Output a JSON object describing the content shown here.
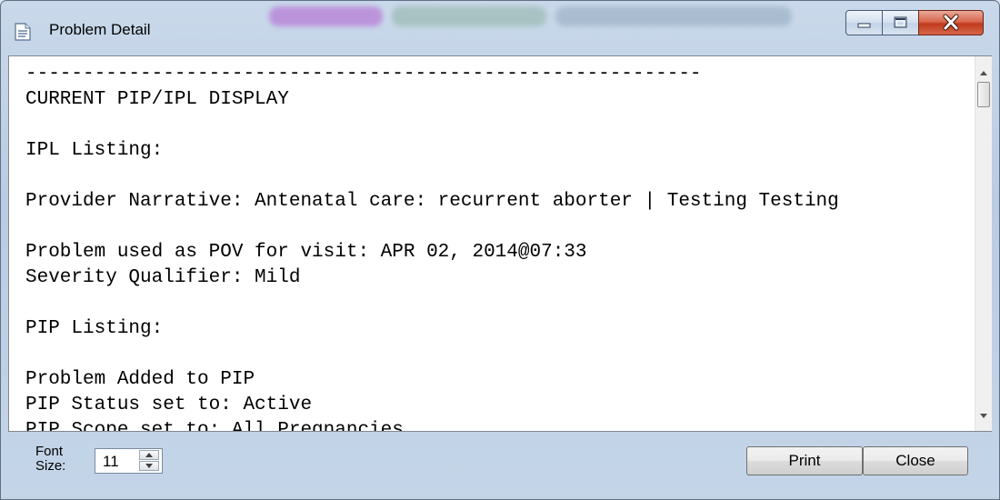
{
  "window": {
    "title": "Problem Detail",
    "icon": "document-icon"
  },
  "title_controls": {
    "minimize_icon": "minimize-icon",
    "maximize_icon": "maximize-icon",
    "close_icon": "close-icon",
    "close_color": "#c7401f"
  },
  "report": {
    "lines": [
      "-----------------------------------------------------------",
      "CURRENT PIP/IPL DISPLAY",
      "",
      "IPL Listing:",
      "",
      "Provider Narrative: Antenatal care: recurrent aborter | Testing Testing",
      "",
      "Problem used as POV for visit: APR 02, 2014@07:33",
      "Severity Qualifier: Mild",
      "",
      "PIP Listing:",
      "",
      "Problem Added to PIP",
      "PIP Status set to: Active",
      "PIP Scope set to: All Pregnancies"
    ]
  },
  "footer": {
    "font_size_label": "Font\nSize:",
    "font_size_value": "11",
    "print_label": "Print",
    "close_label": "Close"
  }
}
